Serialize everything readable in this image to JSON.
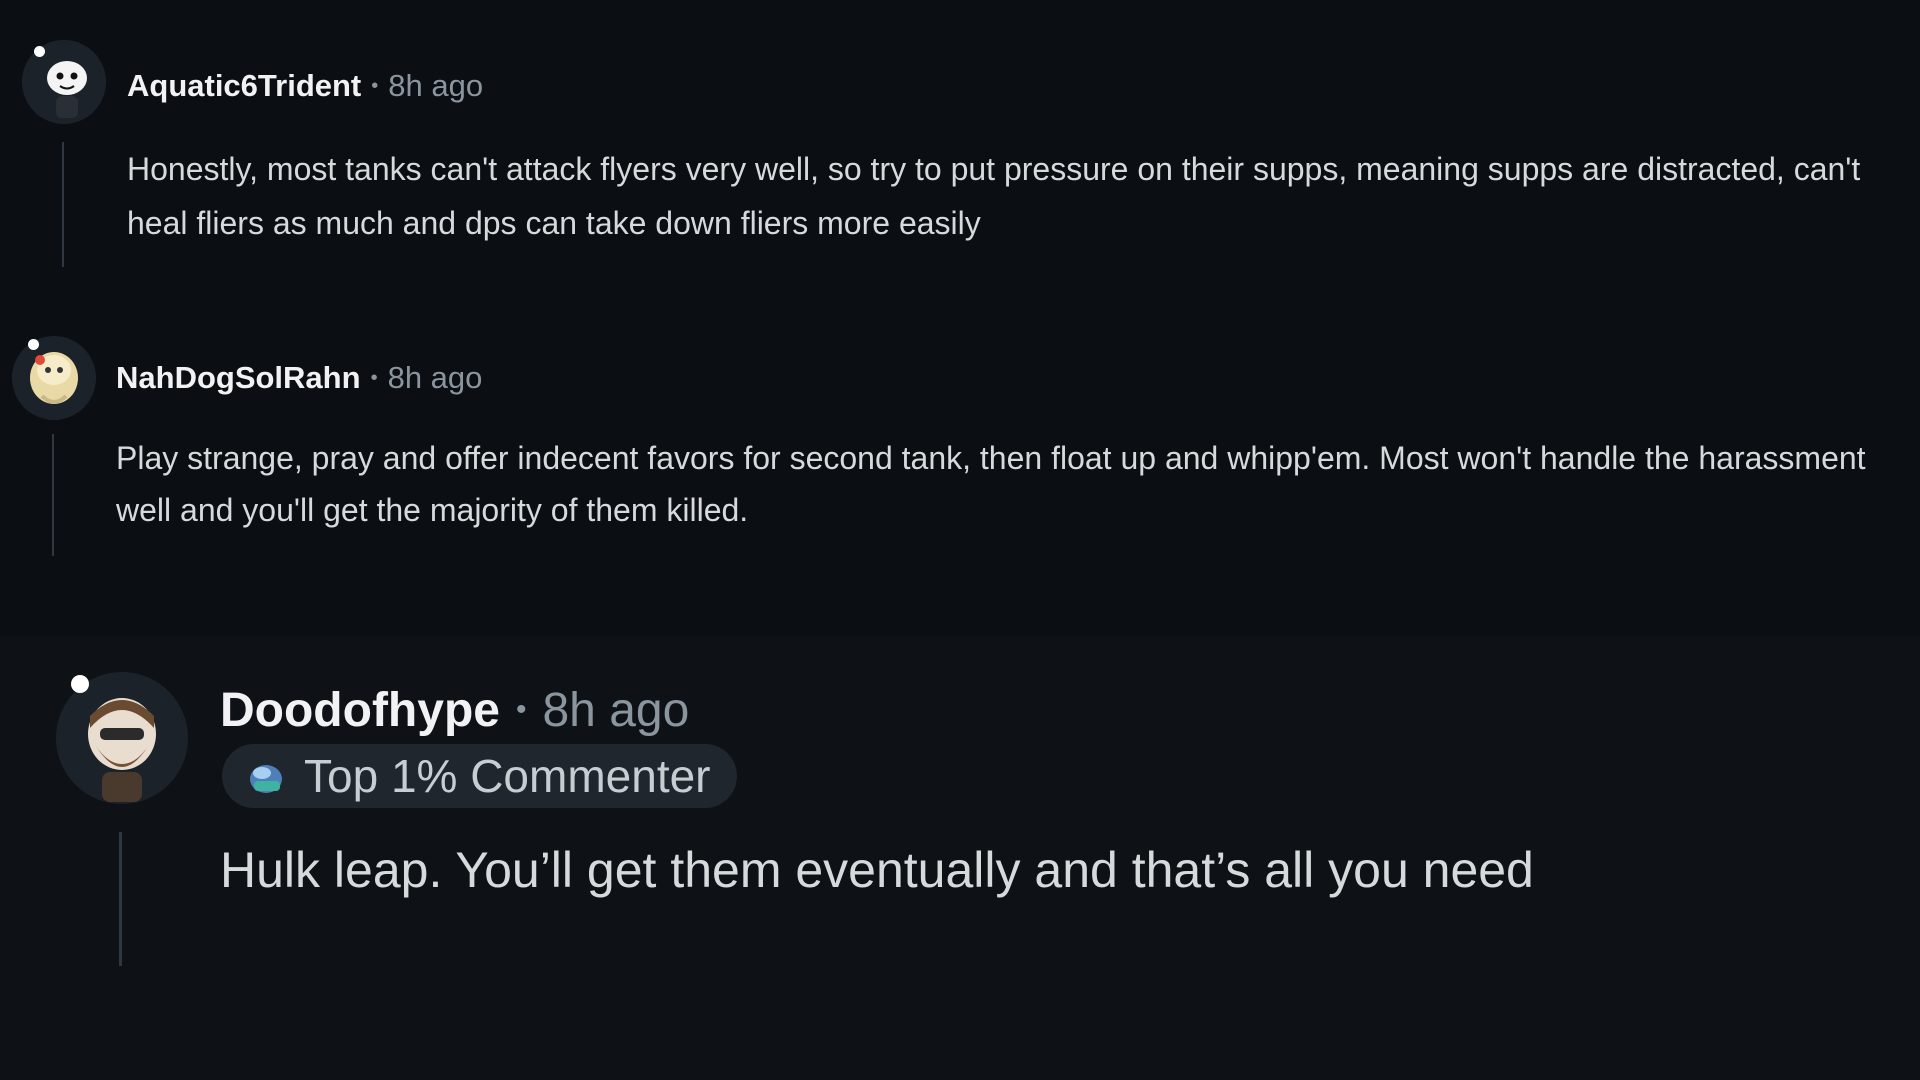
{
  "comments": [
    {
      "username": "Aquatic6Trident",
      "separator": "•",
      "time": "8h ago",
      "body": "Honestly, most tanks can't attack flyers very well, so try to put pressure on their supps, meaning supps are distracted, can't heal fliers as much and dps can take down fliers more easily"
    },
    {
      "username": "NahDogSolRahn",
      "separator": "•",
      "time": "8h ago",
      "body": "Play strange, pray and offer indecent favors for second tank, then float up and whipp'em. Most won't handle the harassment well and you'll get the majority of them killed."
    },
    {
      "username": "Doodofhype",
      "separator": "•",
      "time": "8h ago",
      "flair": "Top 1% Commenter",
      "body": "Hulk leap. You’ll get them eventually and that’s all you need"
    }
  ],
  "colors": {
    "background": "#0b0e12",
    "username": "#f0f2f4",
    "meta": "#8b959e",
    "thread_line": "#2f3740",
    "flair_bg": "#1f262e"
  },
  "icons": {
    "avatar_1": "snoo-avatar",
    "avatar_2": "snoo-avatar",
    "avatar_3": "snoo-avatar",
    "flair_icon": "commenter-badge-icon"
  }
}
